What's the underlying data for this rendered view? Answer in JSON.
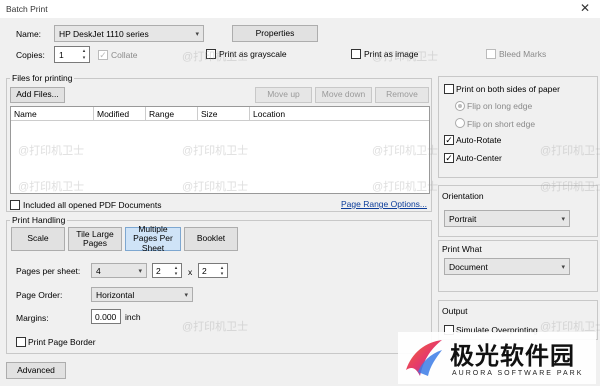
{
  "window": {
    "title": "Batch Print",
    "close_glyph": "✕"
  },
  "printer": {
    "name_label": "Name:",
    "name_value": "HP DeskJet 1110 series",
    "properties_label": "Properties"
  },
  "copies": {
    "label": "Copies:",
    "value": "1",
    "collate_label": "Collate",
    "collate_checked": true
  },
  "options": {
    "grayscale_label": "Print as grayscale",
    "image_label": "Print as image",
    "bleed_label": "Bleed Marks"
  },
  "files": {
    "group_title": "Files for printing",
    "add_files": "Add Files...",
    "move_up": "Move up",
    "move_down": "Move down",
    "remove": "Remove",
    "columns": [
      "Name",
      "Modified",
      "Range",
      "Size",
      "Location"
    ],
    "include_all_label": "Included all opened PDF Documents",
    "page_range_link": "Page Range Options..."
  },
  "handling": {
    "group_title": "Print Handling",
    "modes": [
      "Scale",
      "Tile Large Pages",
      "Multiple Pages Per Sheet",
      "Booklet"
    ],
    "pages_per_sheet_label": "Pages per sheet:",
    "pages_per_sheet_value": "4",
    "cols_value": "2",
    "x_sep": "x",
    "rows_value": "2",
    "page_order_label": "Page Order:",
    "page_order_value": "Horizontal",
    "margins_label": "Margins:",
    "margins_value": "0.000",
    "margins_unit": "inch",
    "border_label": "Print Page Border"
  },
  "duplex": {
    "both_sides_label": "Print on both sides of paper",
    "flip_long_label": "Flip on long edge",
    "flip_short_label": "Flip on short edge",
    "auto_rotate_label": "Auto-Rotate",
    "auto_center_label": "Auto-Center"
  },
  "orientation": {
    "title": "Orientation",
    "value": "Portrait"
  },
  "print_what": {
    "title": "Print What",
    "value": "Document"
  },
  "output": {
    "title": "Output",
    "simulate_label": "Simulate Overprinting"
  },
  "advanced_label": "Advanced",
  "watermarks": {
    "text": "@打印机卫士"
  },
  "logo": {
    "cn_text": "极光软件园",
    "en_text": "AURORA SOFTWARE PARK"
  },
  "glyphs": {
    "check": "✓",
    "down_arrow": "▾",
    "up_arrow": "▴"
  }
}
